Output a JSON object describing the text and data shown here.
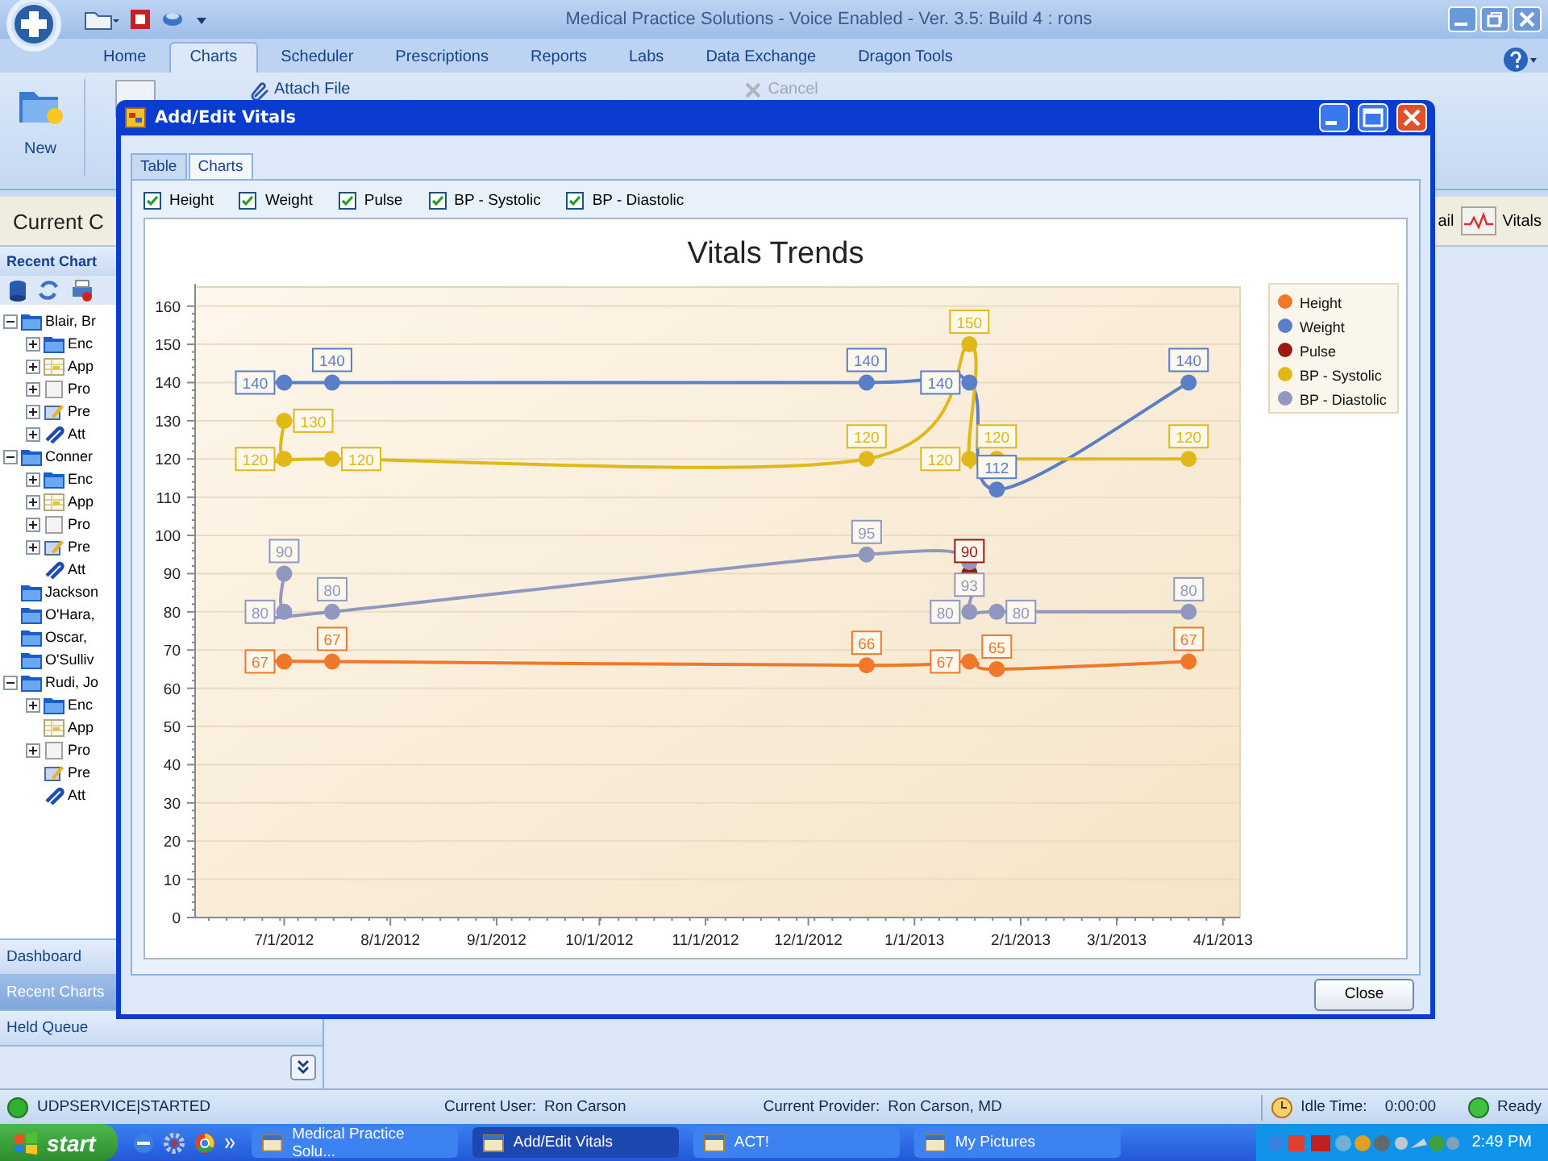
{
  "app": {
    "title": "Medical Practice Solutions - Voice Enabled - Ver. 3.5: Build 4 : rons",
    "ribbon_tabs": [
      {
        "label": "Home",
        "selected": false
      },
      {
        "label": "Charts",
        "selected": true
      },
      {
        "label": "Scheduler",
        "selected": false
      },
      {
        "label": "Prescriptions",
        "selected": false
      },
      {
        "label": "Reports",
        "selected": false
      },
      {
        "label": "Labs",
        "selected": false
      },
      {
        "label": "Data Exchange",
        "selected": false
      },
      {
        "label": "Dragon Tools",
        "selected": false
      }
    ],
    "ribbon_buttons": [
      {
        "kind": "large",
        "label": "New",
        "disabled": false
      },
      {
        "kind": "small",
        "label": "Attach File",
        "disabled": false
      },
      {
        "kind": "small",
        "label": "Cancel",
        "disabled": true
      }
    ],
    "header": {
      "title": "Current C",
      "right_label": "ail",
      "vitals_button": "Vitals"
    }
  },
  "sidebar": {
    "title": "Recent Chart",
    "tree": [
      {
        "label": "Blair, Br",
        "kind": "patient",
        "expanded": true,
        "children": [
          {
            "label": "Enc",
            "kind": "folder",
            "expanded": false
          },
          {
            "label": "App",
            "kind": "appointments",
            "expanded": false
          },
          {
            "label": "Pro",
            "kind": "problems",
            "expanded": false
          },
          {
            "label": "Pre",
            "kind": "prescriptions",
            "expanded": false
          },
          {
            "label": "Att",
            "kind": "attachments",
            "expanded": false
          }
        ]
      },
      {
        "label": "Conner",
        "kind": "patient",
        "expanded": true,
        "children": [
          {
            "label": "Enc",
            "kind": "folder",
            "expanded": false
          },
          {
            "label": "App",
            "kind": "appointments",
            "expanded": false
          },
          {
            "label": "Pro",
            "kind": "problems",
            "expanded": false
          },
          {
            "label": "Pre",
            "kind": "prescriptions",
            "expanded": false
          },
          {
            "label": "Att",
            "kind": "attachments"
          }
        ]
      },
      {
        "label": "Jackson",
        "kind": "patient"
      },
      {
        "label": "O'Hara,",
        "kind": "patient"
      },
      {
        "label": "Oscar,",
        "kind": "patient"
      },
      {
        "label": "O'Sulliv",
        "kind": "patient"
      },
      {
        "label": "Rudi, Jo",
        "kind": "patient",
        "expanded": true,
        "children": [
          {
            "label": "Enc",
            "kind": "folder",
            "expanded": false
          },
          {
            "label": "App",
            "kind": "appointments"
          },
          {
            "label": "Pro",
            "kind": "problems",
            "expanded": false
          },
          {
            "label": "Pre",
            "kind": "prescriptions"
          },
          {
            "label": "Att",
            "kind": "attachments"
          }
        ]
      }
    ],
    "nav": [
      {
        "label": "Dashboard",
        "selected": false
      },
      {
        "label": "Recent Charts",
        "selected": true
      },
      {
        "label": "Held Queue",
        "selected": false
      }
    ]
  },
  "dialog": {
    "title": "Add/Edit Vitals",
    "tabs": [
      {
        "label": "Table",
        "selected": false
      },
      {
        "label": "Charts",
        "selected": true
      }
    ],
    "series_toggles": [
      {
        "label": "Height",
        "checked": true
      },
      {
        "label": "Weight",
        "checked": true
      },
      {
        "label": "Pulse",
        "checked": true
      },
      {
        "label": "BP - Systolic",
        "checked": true
      },
      {
        "label": "BP - Diastolic",
        "checked": true
      }
    ],
    "chart": {
      "chart_data": {
        "type": "line",
        "title": "Vitals Trends",
        "x": [
          "2012-07-01",
          "2012-07-01",
          "2012-07-15",
          "2012-12-18",
          "2013-01-17",
          "2013-01-17",
          "2013-01-25",
          "2013-03-22"
        ],
        "xlim": [
          "2012-06-05",
          "2013-04-06"
        ],
        "ylim": [
          0,
          165
        ],
        "xticks": [
          {
            "value": "2012-07-01",
            "label": "7/1/2012"
          },
          {
            "value": "2012-08-01",
            "label": "8/1/2012"
          },
          {
            "value": "2012-09-01",
            "label": "9/1/2012"
          },
          {
            "value": "2012-10-01",
            "label": "10/1/2012"
          },
          {
            "value": "2012-11-01",
            "label": "11/1/2012"
          },
          {
            "value": "2012-12-01",
            "label": "12/1/2012"
          },
          {
            "value": "2013-01-01",
            "label": "1/1/2013"
          },
          {
            "value": "2013-02-01",
            "label": "2/1/2013"
          },
          {
            "value": "2013-03-01",
            "label": "3/1/2013"
          },
          {
            "value": "2013-04-01",
            "label": "4/1/2013"
          }
        ],
        "yticks": [
          0,
          10,
          20,
          30,
          40,
          50,
          60,
          70,
          80,
          90,
          100,
          110,
          120,
          130,
          140,
          150,
          160
        ],
        "data_labels": true,
        "grid": true,
        "legend": true,
        "series": [
          {
            "name": "Height",
            "color": "#f07828",
            "marker": "circle",
            "values": [
              67,
              null,
              67,
              66,
              67,
              null,
              65,
              67
            ]
          },
          {
            "name": "Weight",
            "color": "#5a7ec8",
            "marker": "circle",
            "values": [
              140,
              null,
              140,
              140,
              140,
              null,
              112,
              140
            ]
          },
          {
            "name": "Pulse",
            "color": "#9a1a10",
            "marker": "circle",
            "values": [
              null,
              null,
              null,
              null,
              90,
              null,
              null,
              null
            ]
          },
          {
            "name": "BP - Systolic",
            "color": "#e0b818",
            "marker": "circle",
            "values": [
              130,
              120,
              120,
              120,
              150,
              120,
              120,
              120
            ]
          },
          {
            "name": "BP - Diastolic",
            "color": "#9098c0",
            "marker": "circle",
            "values": [
              90,
              80,
              80,
              95,
              93,
              80,
              80,
              80
            ]
          }
        ]
      }
    },
    "close_button": "Close"
  },
  "status_bar": {
    "service": "UDPSERVICE|STARTED",
    "user_label": "Current User:",
    "user": "Ron Carson",
    "provider_label": "Current Provider:",
    "provider": "Ron Carson, MD",
    "idle_label": "Idle Time:",
    "idle": "0:00:00",
    "state": "Ready"
  },
  "taskbar": {
    "start": "start",
    "tasks": [
      {
        "label": "Medical Practice Solu...",
        "selected": false
      },
      {
        "label": "Add/Edit Vitals",
        "selected": true
      },
      {
        "label": "ACT!",
        "selected": false
      },
      {
        "label": "My Pictures",
        "selected": false
      }
    ],
    "clock": "2:49 PM"
  }
}
